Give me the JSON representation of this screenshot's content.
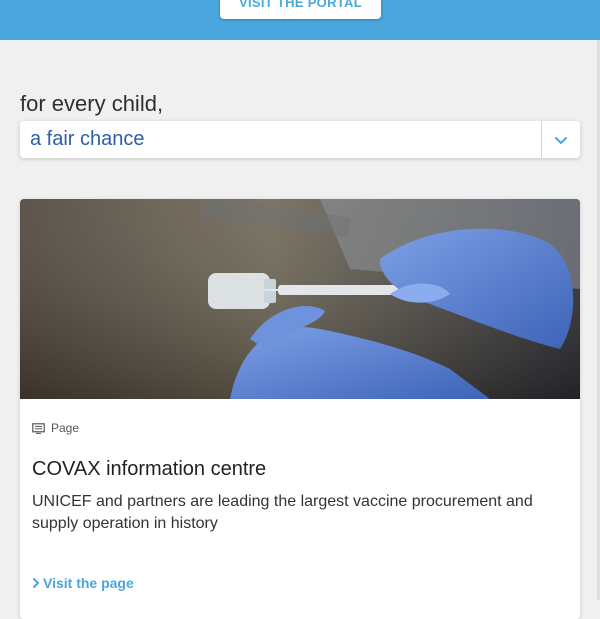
{
  "header": {
    "portal_button_label": "VISIT THE PORTAL",
    "color": "#4aa6dc"
  },
  "tagline": {
    "prefix": "for every child,",
    "selected_value": "a fair chance",
    "dropdown_icon": "chevron-down-icon",
    "accent_color": "#2d5ea8"
  },
  "card": {
    "image_icon": "vaccine-photo",
    "type_icon": "page-icon",
    "type_label": "Page",
    "title": "COVAX information centre",
    "description": "UNICEF and partners are leading the largest vaccine procurement and supply operation in history",
    "link_icon": "chevron-right-icon",
    "link_label": "Visit the page",
    "link_color": "#4aa6dc"
  }
}
